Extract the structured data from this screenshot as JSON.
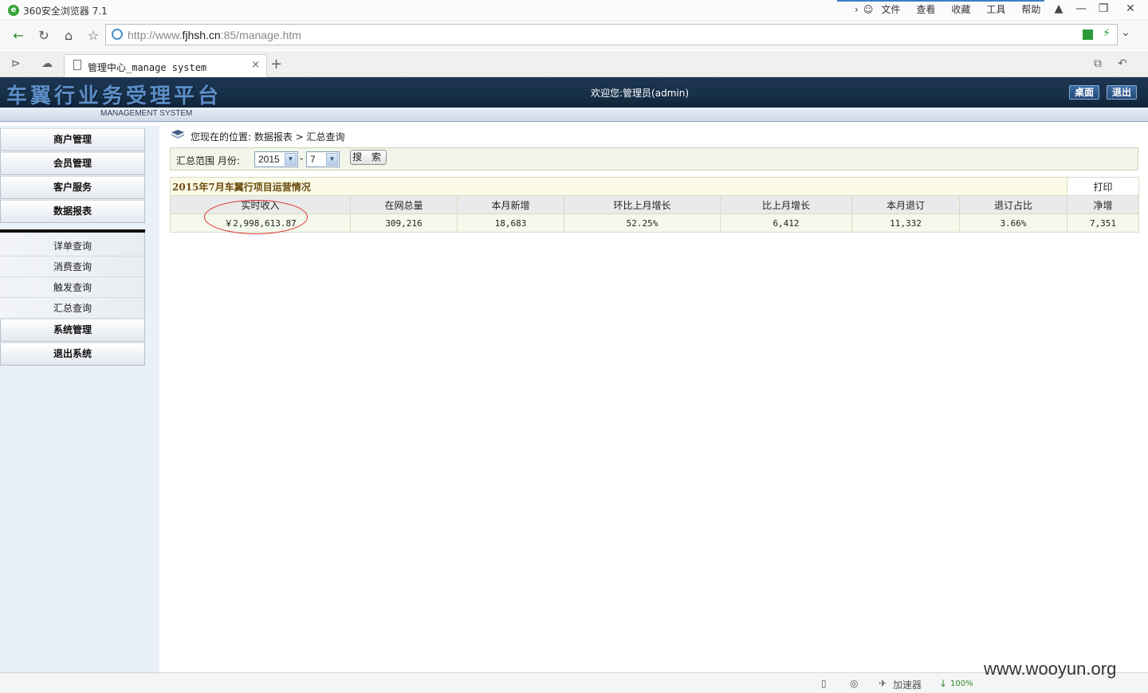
{
  "browser": {
    "title": "360安全浏览器 7.1",
    "menu": [
      "文件",
      "查看",
      "收藏",
      "工具",
      "帮助"
    ],
    "url_prefix": "http://www.",
    "url_domain": "fjhsh.cn",
    "url_suffix": ":85/manage.htm",
    "tab_label": "管理中心_manage system",
    "tab_close": "×",
    "new_tab": "+"
  },
  "header": {
    "title": "车翼行业务受理平台",
    "subtitle": "MANAGEMENT SYSTEM",
    "welcome": "欢迎您:管理员(admin)",
    "desktop_button": "桌面",
    "logout_button": "退出"
  },
  "sidebar": {
    "top_items": [
      "商户管理",
      "会员管理",
      "客户服务",
      "数据报表"
    ],
    "sub_items": [
      "详单查询",
      "消费查询",
      "触发查询",
      "汇总查询"
    ],
    "bottom_items": [
      "系统管理",
      "退出系统"
    ]
  },
  "breadcrumb": {
    "text": "您现在的位置: 数据报表 > 汇总查询"
  },
  "filter": {
    "label": "汇总范围  月份:",
    "year": "2015",
    "separator": "-",
    "month": "7",
    "search_button": "搜 索"
  },
  "report": {
    "caption": "2015年7月车翼行项目运营情况",
    "print": "打印",
    "headers": [
      "实时收入",
      "在网总量",
      "本月新增",
      "环比上月增长",
      "比上月增长",
      "本月退订",
      "退订占比",
      "净增"
    ],
    "values": [
      "￥2,998,613.87",
      "309,216",
      "18,683",
      "52.25%",
      "6,412",
      "11,332",
      "3.66%",
      "7,351"
    ]
  },
  "statusbar": {
    "accelerator": "加速器",
    "download_pct": "100%",
    "zoom": "100%"
  },
  "watermark": "www.wooyun.org",
  "colors": {
    "header_bg": "#173048",
    "sidebar_bg": "#eaf0f8",
    "caption_text": "#6b4a0e",
    "highlight_ellipse": "#e03030"
  }
}
